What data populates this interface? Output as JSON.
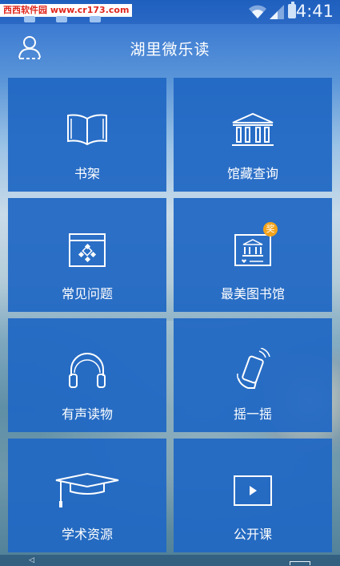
{
  "status_bar": {
    "watermark": "西西软件园 www.cr173.com",
    "time": "4:41"
  },
  "header": {
    "title": "湖里微乐读",
    "user_icon": "user-icon"
  },
  "tiles": [
    {
      "label": "书架",
      "icon": "book-icon"
    },
    {
      "label": "馆藏查询",
      "icon": "library-building-icon"
    },
    {
      "label": "常见问题",
      "icon": "faq-icon"
    },
    {
      "label": "最美图书馆",
      "icon": "beautiful-library-icon",
      "badge": "奖"
    },
    {
      "label": "有声读物",
      "icon": "headphones-icon"
    },
    {
      "label": "摇一摇",
      "icon": "shake-phone-icon"
    },
    {
      "label": "学术资源",
      "icon": "graduation-cap-icon"
    },
    {
      "label": "公开课",
      "icon": "play-video-icon"
    }
  ],
  "colors": {
    "tile_bg": "#2168c4",
    "badge": "#f3a21a",
    "watermark_text": "#e0251b"
  }
}
